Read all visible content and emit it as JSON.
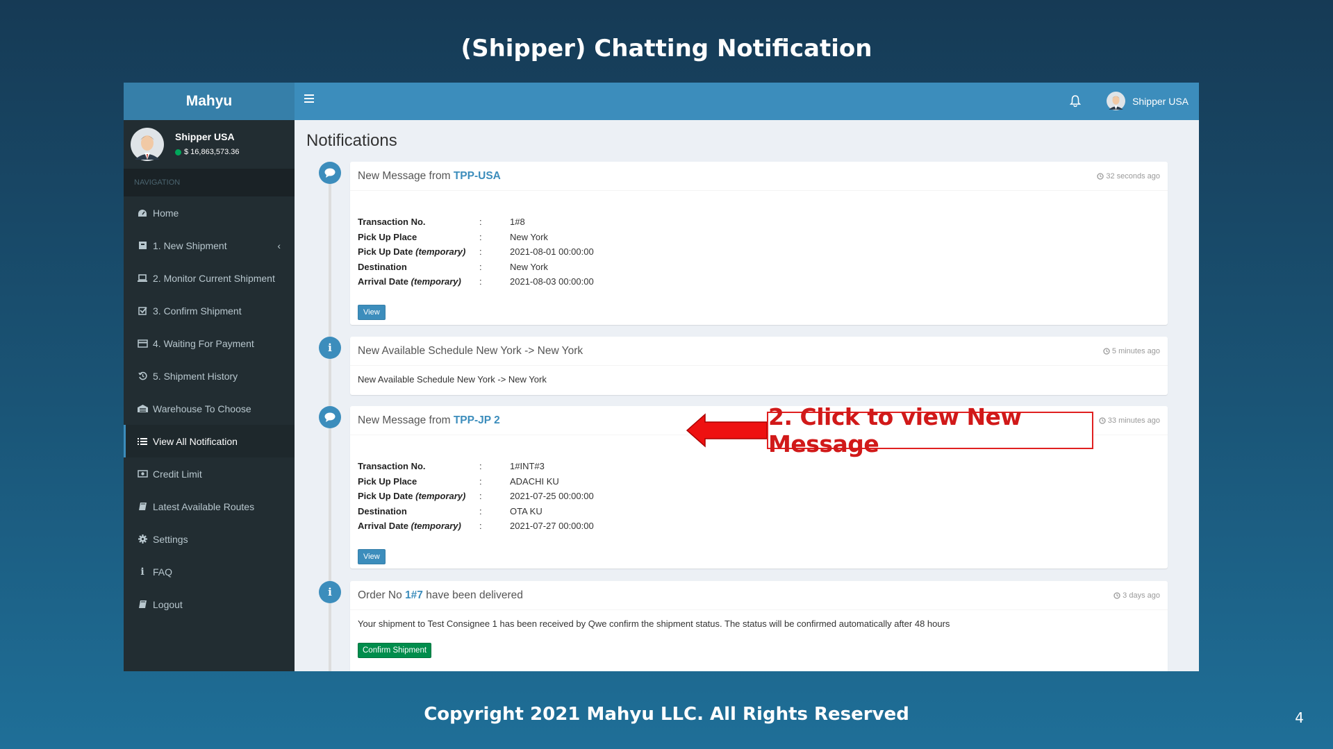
{
  "slide": {
    "title": "(Shipper) Chatting Notification",
    "footer": "Copyright 2021 Mahyu LLC. All Rights Reserved",
    "page_number": "4",
    "callout": "2. Click to view New Message"
  },
  "sidebar": {
    "brand": "Mahyu",
    "user": {
      "name": "Shipper USA",
      "balance": "$ 16,863,573.36",
      "status_color": "#00a65a"
    },
    "nav_header": "NAVIGATION",
    "items": [
      {
        "label": "Home",
        "icon": "dashboard-icon"
      },
      {
        "label": "1. New Shipment",
        "icon": "box-icon",
        "has_submenu": true
      },
      {
        "label": "2. Monitor Current Shipment",
        "icon": "laptop-icon"
      },
      {
        "label": "3. Confirm Shipment",
        "icon": "check-square-icon"
      },
      {
        "label": "4. Waiting For Payment",
        "icon": "credit-card-icon"
      },
      {
        "label": "5. Shipment History",
        "icon": "history-icon"
      },
      {
        "label": "Warehouse To Choose",
        "icon": "warehouse-icon"
      },
      {
        "label": "View All Notification",
        "icon": "list-icon",
        "active": true
      },
      {
        "label": "Credit Limit",
        "icon": "money-icon"
      },
      {
        "label": "Latest Available Routes",
        "icon": "book-icon"
      },
      {
        "label": "Settings",
        "icon": "gear-icon"
      },
      {
        "label": "FAQ",
        "icon": "info-icon"
      },
      {
        "label": "Logout",
        "icon": "book-icon"
      }
    ]
  },
  "topbar": {
    "user_name": "Shipper USA"
  },
  "content": {
    "title": "Notifications",
    "labels": {
      "transaction_no": "Transaction No.",
      "pickup_place": "Pick Up Place",
      "pickup_date": "Pick Up Date",
      "destination": "Destination",
      "arrival_date": "Arrival Date",
      "temporary": "(temporary)",
      "colon": ":",
      "view": "View"
    },
    "notifications": [
      {
        "prefix": "New Message from ",
        "link": "TPP-USA",
        "time": "32 seconds ago",
        "transaction_no": "1#8",
        "pickup_place": "New York",
        "pickup_date": "2021-08-01 00:00:00",
        "destination": "New York",
        "arrival_date": "2021-08-03 00:00:00"
      },
      {
        "title": "New Available Schedule New York -> New York",
        "time": "5 minutes ago",
        "body": "New Available Schedule New York -> New York"
      },
      {
        "prefix": "New Message from ",
        "link": "TPP-JP 2",
        "time": "33 minutes ago",
        "transaction_no": "1#INT#3",
        "pickup_place": "ADACHI KU",
        "pickup_date": "2021-07-25 00:00:00",
        "destination": "OTA KU",
        "arrival_date": "2021-07-27 00:00:00"
      },
      {
        "prefix": "Order No ",
        "link": "1#7",
        "suffix": " have been delivered",
        "time": "3 days ago",
        "body": "Your shipment to Test Consignee 1 has been received by Qwe confirm the shipment status. The status will be confirmed automatically after 48 hours",
        "button": "Confirm Shipment"
      }
    ]
  },
  "colors": {
    "brand": "#367fa9",
    "topbar": "#3c8dbc",
    "sidebar": "#222d32",
    "success": "#008d4c",
    "callout": "#e02020"
  }
}
